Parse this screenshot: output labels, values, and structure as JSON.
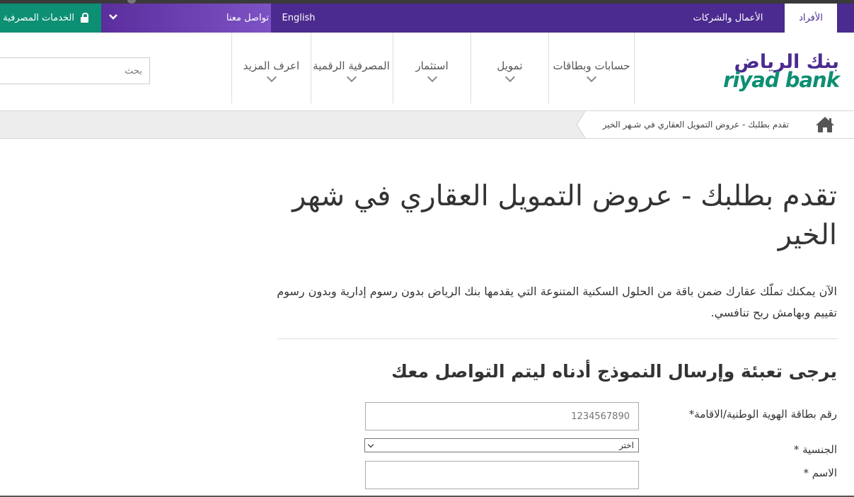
{
  "top_bar": {
    "online_banking_label": "الخدمات المصرفية عبر الإنترنت",
    "contact_label": "تواصل معنا",
    "language_label": "English",
    "business_label": "الأعمال والشركات",
    "individuals_label": "الأفراد",
    "colors": {
      "bar": "#4b2b8f",
      "online": "#0d8f73"
    }
  },
  "header": {
    "search_placeholder": "بحث",
    "logo": {
      "arabic": "بنك الرياض",
      "english": "riyad bank"
    },
    "nav": [
      {
        "label": "حسابات وبطاقات"
      },
      {
        "label": "تمويل"
      },
      {
        "label": "استثمار"
      },
      {
        "label": "المصرفية الرقمية"
      },
      {
        "label": "اعرف المزيد"
      }
    ]
  },
  "breadcrumb": {
    "current": "تقدم بطلبك - عروض التمويل العقاري في شـهر الخير"
  },
  "main": {
    "title": "تقدم بطلبك - عروض التمويل العقاري في شهر الخير",
    "intro": "الآن يمكنك تملّك عقارك ضمن باقة من الحلول السكنية المتنوعة التي يقدمها بنك الرياض بدون رسوم إدارية وبدون رسوم تقييم وبهامش ربح تنافسي.",
    "form_title": "يرجى تعبئة وإرسال النموذج أدناه ليتم التواصل معك",
    "fields": {
      "id_label": "رقم بطاقة الهوية الوطنية/الاقامة*",
      "id_placeholder": "1234567890",
      "nationality_label": "الجنسية *",
      "nationality_value": "اختر",
      "name_label": "الاسم *"
    }
  }
}
